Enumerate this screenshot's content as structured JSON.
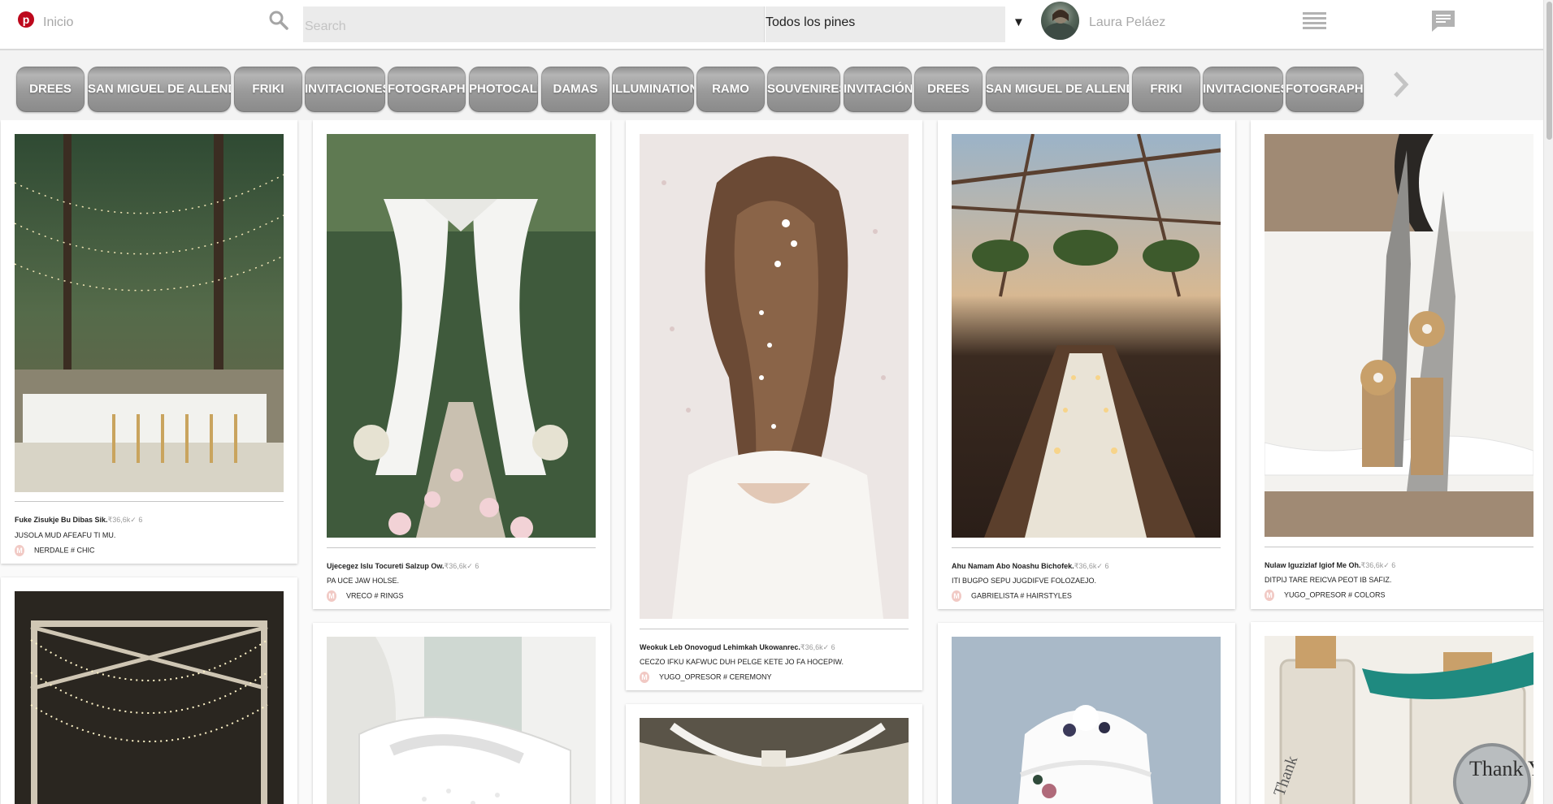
{
  "header": {
    "logo_letter": "p",
    "home_label": "Inicio",
    "search_placeholder": "Search",
    "filter_value": "Todos los pines",
    "filter_caret": "▼",
    "user_name": "Laura Peláez"
  },
  "categories": {
    "items": [
      "DREES",
      "SAN MIGUEL DE ALLENDE",
      "FRIKI",
      "INVITACIONES",
      "FOTOGRAPHY",
      "PHOTOCALL",
      "DAMAS",
      "ILLUMINATION",
      "RAMO",
      "SOUVENIRES",
      "INVITACIÓN",
      "DREES",
      "SAN MIGUEL DE ALLENDE",
      "FRIKI",
      "INVITACIONES",
      "FOTOGRAPHY"
    ]
  },
  "pins": [
    {
      "title": "Fuke Zisukje Bu Dibas Sik.",
      "stats": "₹36,6k✓ 6",
      "description": "JUSOLA MUD AFEAFU TI MU.",
      "badge": "M",
      "board": "NERDALE # CHIC"
    },
    {
      "title": "Ujecegez Islu Tocureti Salzup Ow.",
      "stats": "₹36,6k✓ 6",
      "description": "PA UCE JAW HOLSE.",
      "badge": "M",
      "board": "VRECO # RINGS"
    },
    {
      "title": "Weokuk Leb Onovogud Lehimkah Ukowanrec.",
      "stats": "₹36,6k✓ 6",
      "description": "CECZO IFKU KAFWUC DUH PELGE KETE JO FA HOCEPIW.",
      "badge": "M",
      "board": "YUGO_OPRESOR # CEREMONY"
    },
    {
      "title": "Ahu Namam Abo Noashu Bichofek.",
      "stats": "₹36,6k✓ 6",
      "description": "ITI BUGPO SEPU JUGDIFVE FOLOZAEJO.",
      "badge": "M",
      "board": "GABRIELISTA # HAIRSTYLES"
    },
    {
      "title": "Nulaw Iguzizlaf Igiof Me Oh.",
      "stats": "₹36,6k✓ 6",
      "description": "DITPIJ TARE REICVA PEOT IB SAFIZ.",
      "badge": "M",
      "board": "YUGO_OPRESOR # COLORS"
    }
  ],
  "image_texts": {
    "thank_you_tag": "Thank You",
    "thank_small": "Thank"
  },
  "colors": {
    "brand": "#bd081c",
    "chip": "#9a9a9a",
    "badge": "#f1c9c4"
  },
  "icons": {
    "search": "search-icon",
    "menu": "menu-icon",
    "messages": "messages-icon",
    "next": "chevron-right-icon"
  }
}
